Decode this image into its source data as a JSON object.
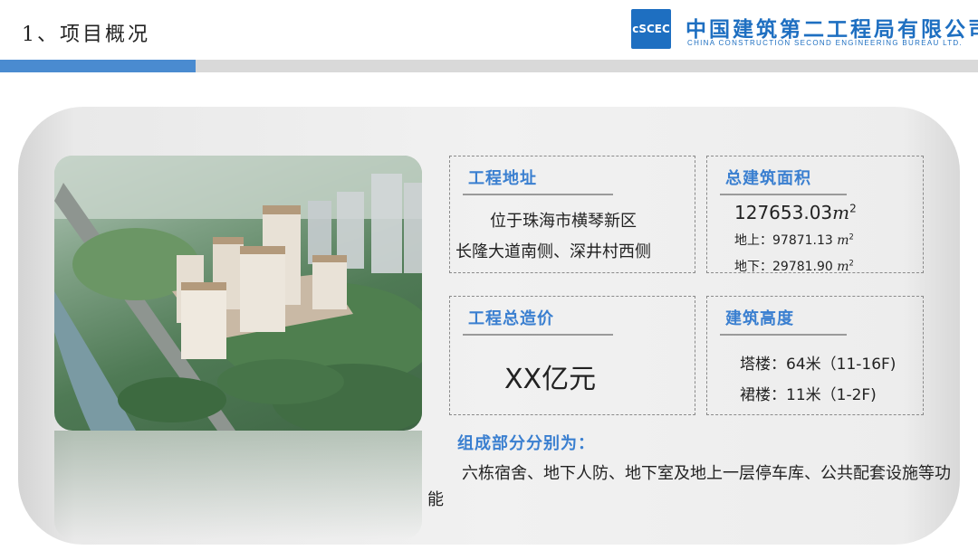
{
  "header": {
    "title": "1、项目概况",
    "logo_mark": "cSCEC",
    "company_cn": "中国建筑第二工程局有限公司",
    "company_en": "CHINA CONSTRUCTION SECOND ENGINEERING BUREAU LTD."
  },
  "address": {
    "heading": "工程地址",
    "line1": "位于珠海市横琴新区",
    "line2": "长隆大道南侧、深井村西侧"
  },
  "area": {
    "heading": "总建筑面积",
    "total": "127653.03",
    "above": "地上：97871.13",
    "below": "地下：29781.90",
    "unit": "m",
    "unit_exp": "2"
  },
  "cost": {
    "heading": "工程总造价",
    "value": "XX亿元"
  },
  "height": {
    "heading": "建筑高度",
    "tower": "塔楼：64米（11-16F)",
    "podium": "裙楼：11米（1-2F)"
  },
  "composition": {
    "heading": "组成部分分别为：",
    "text": "六栋宿舍、地下人防、地下室及地上一层停车库、公共配套设施等功能"
  },
  "colors": {
    "accent_blue": "#3a7fd0",
    "bar_blue": "#4a8bd0",
    "bar_gray": "#d9d9d9",
    "logo_blue": "#1e6fc1"
  }
}
